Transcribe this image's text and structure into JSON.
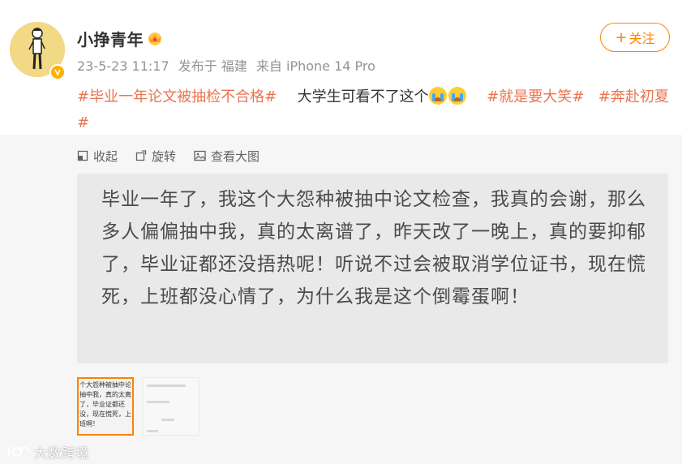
{
  "post": {
    "username": "小挣青年",
    "meta": {
      "date": "23-5-23 11:17",
      "location": "发布于 福建",
      "source": "来自 iPhone 14 Pro"
    },
    "follow_label": "关注",
    "follow_icon": "plus-icon",
    "text_segments": {
      "hashtag1": "#毕业一年论文被抽检不合格#",
      "body": "大学生可看不了这个",
      "emoji": "crying-face",
      "hashtag2": "#就是要大笑#",
      "hashtag3": "#奔赴初夏#"
    }
  },
  "media_toolbar": {
    "collapse": "收起",
    "rotate": "旋转",
    "view_large": "查看大图"
  },
  "image_text": "毕业一年了，我这个大怨种被抽中论文检查，我真的会谢，那么多人偏偏抽中我，真的太离谱了，昨天改了一晚上，真的要抑郁了，毕业证都还没捂热呢！听说不过会被取消学位证书，现在慌死，上班都没心情了，为什么我是这个倒霉蛋啊！",
  "thumbnails": {
    "first_text": "个大怨种被抽中论抽中我，真的太离了，毕业证都还没，现在慌死，上班啊！"
  },
  "watermark": "大数跨境",
  "colors": {
    "accent": "#ff8200",
    "hashtag": "#eb7350",
    "verified": "#ffb000"
  }
}
